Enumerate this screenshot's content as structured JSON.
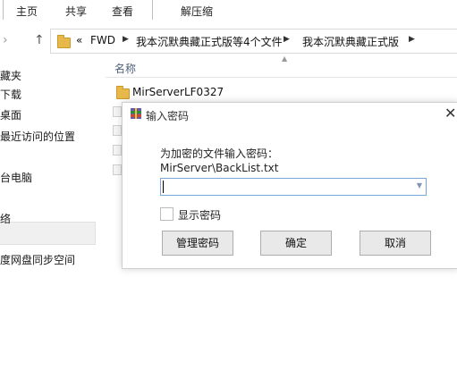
{
  "ribbon": {
    "tabs": [
      "主页",
      "共享",
      "查看",
      "解压缩"
    ]
  },
  "address": {
    "prefix": "«",
    "crumbs": [
      "FWD",
      "我本沉默典藏正式版等4个文件",
      "我本沉默典藏正式版"
    ]
  },
  "nav": {
    "items": [
      "收藏夹",
      "下载",
      "桌面",
      "最近访问的位置",
      "这台电脑",
      "网络",
      "百度网盘同步空间"
    ]
  },
  "file_list": {
    "column_name": "名称",
    "rows": [
      "MirServerLF0327"
    ]
  },
  "dialog": {
    "title": "输入密码",
    "prompt": "为加密的文件输入密码：",
    "file_path": "MirServer\\BackList.txt",
    "password_value": "",
    "show_password_label": "显示密码",
    "buttons": {
      "manage": "管理密码",
      "ok": "确定",
      "cancel": "取消"
    }
  },
  "icons": {
    "close": "close-icon",
    "back": "back-arrow-icon",
    "up": "up-arrow-icon",
    "folder": "folder-icon",
    "app": "winrar-icon",
    "dropdown": "chevron-down-icon"
  },
  "colors": {
    "input_border": "#7aa7d9",
    "folder": "#e8b94a",
    "column_header_text": "#4c607a"
  }
}
